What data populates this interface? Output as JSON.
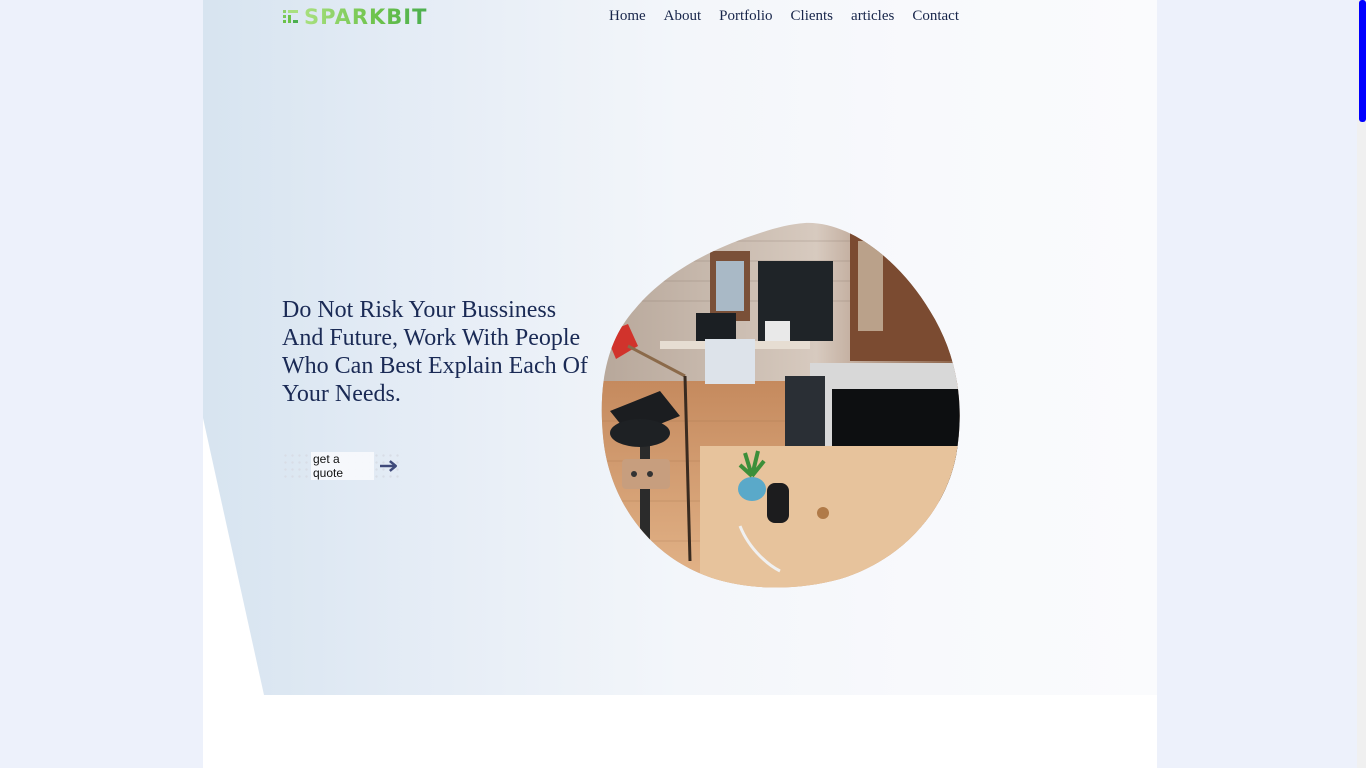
{
  "brand": {
    "name": "SPARKBIT",
    "logo_icon": "sparkbit-logo-mark",
    "colors": {
      "logo_gradient_start": "#a9e07f",
      "logo_gradient_end": "#4caf50"
    }
  },
  "nav": {
    "items": [
      {
        "label": "Home"
      },
      {
        "label": "About"
      },
      {
        "label": "Portfolio"
      },
      {
        "label": "Clients"
      },
      {
        "label": "articles"
      },
      {
        "label": "Contact"
      }
    ]
  },
  "hero": {
    "headline": "Do Not Risk Your Bussiness And Future, Work With People Who Can Best Explain Each Of Your Needs.",
    "cta_label": "get a quote",
    "cta_icon": "arrow-right-icon",
    "image_subject": "office workspace photo",
    "colors": {
      "headline": "#1a2a55",
      "accent": "#3f4a7a"
    }
  },
  "scrollbar": {
    "thumb_color": "#0000ff",
    "position": 0
  }
}
